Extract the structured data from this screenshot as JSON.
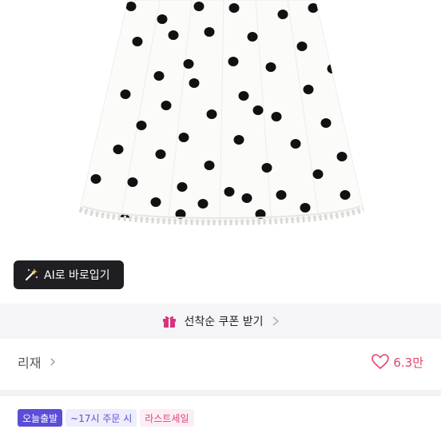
{
  "ai_button": {
    "label": "AI로 바로입기",
    "icon": "magic-wand-icon"
  },
  "coupon": {
    "label": "선착순 쿠폰 받기",
    "icon": "gift-icon",
    "accent": "#d6337a"
  },
  "material": {
    "label": "리재"
  },
  "likes": {
    "count": "6.3만",
    "icon": "heart-icon",
    "color": "#e2436b"
  },
  "badges": {
    "today": "오늘출발",
    "time": "~17시 주문 시",
    "last": "라스트세일"
  },
  "colors": {
    "badge_purple": "#5a4ed8",
    "badge_pink": "#e0467f"
  }
}
